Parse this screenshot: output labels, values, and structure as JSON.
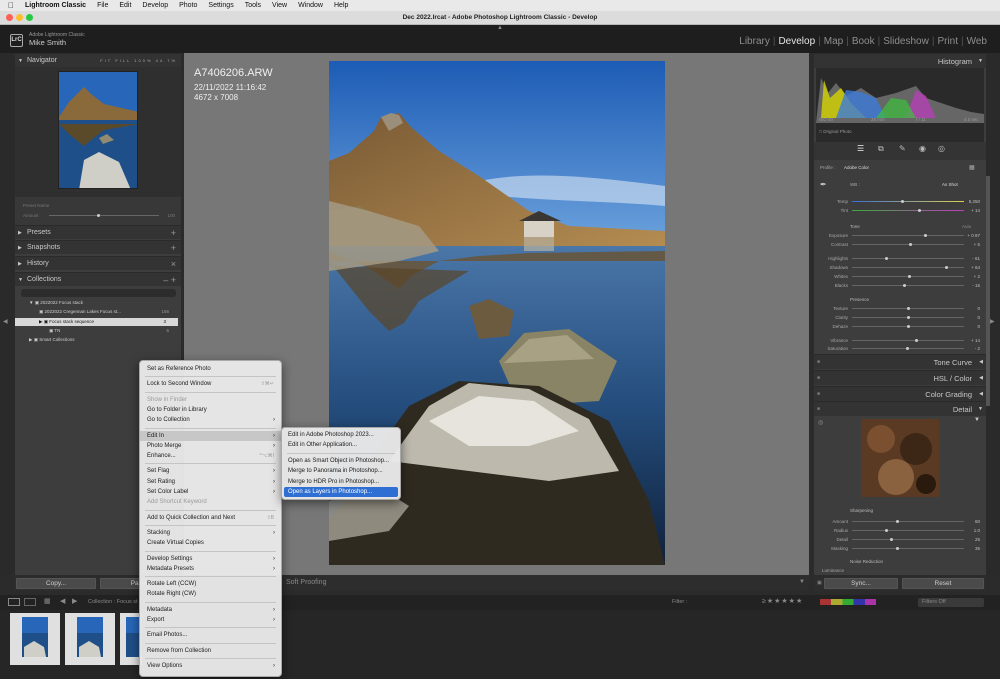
{
  "menubar": {
    "app": "Lightroom Classic",
    "items": [
      "File",
      "Edit",
      "Develop",
      "Photo",
      "Settings",
      "Tools",
      "View",
      "Window",
      "Help"
    ]
  },
  "window": {
    "title": "Dec 2022.lrcat - Adobe Photoshop Lightroom Classic - Develop"
  },
  "identity": {
    "badge": "LrC",
    "product": "Adobe Lightroom Classic",
    "user": "Mike Smith"
  },
  "modules": [
    "Library",
    "Develop",
    "Map",
    "Book",
    "Slideshow",
    "Print",
    "Web"
  ],
  "left_panel": {
    "navigator": "Navigator",
    "nav_zoom": [
      "FIT",
      "FILL",
      "100%",
      "44.7%"
    ],
    "presets": "Presets",
    "snapshots": "Snapshots",
    "history": "History",
    "collections": "Collections",
    "preset_amount": "Preset Name",
    "preset_amount_label": "Amount",
    "preset_amount_value": "100",
    "collection_items": [
      {
        "label": "2022022 Focus stack",
        "count": ""
      },
      {
        "label": "2022022 Cregennan Lakes Focus st...",
        "count": "156"
      },
      {
        "label": "Focus stack sequence",
        "count": "3"
      },
      {
        "label": "TN",
        "count": "6"
      },
      {
        "label": "Smart Collections",
        "count": ""
      }
    ],
    "copy_button": "Copy...",
    "paste_button": "Paste"
  },
  "image_info": {
    "filename": "A7406206.ARW",
    "datetime": "22/11/2022 11:16:42",
    "dimensions": "4672 x 7008"
  },
  "toolbar": {
    "soft_proofing": "Soft Proofing"
  },
  "right_panel": {
    "histogram": "Histogram",
    "hist_info": [
      "ISO 50",
      "28 mm",
      "f / 11",
      "4.0 sec"
    ],
    "original_photo": "Original Photo",
    "profile_label": "Profile :",
    "profile_value": "Adobe Color",
    "wb_label": "WB :",
    "wb_value": "As Shot",
    "basic": [
      {
        "label": "Temp",
        "value": "5,250"
      },
      {
        "label": "Tint",
        "value": "+ 14"
      }
    ],
    "tone_section": "Tone",
    "tone_auto": "Auto",
    "tone": [
      {
        "label": "Exposure",
        "value": "+ 0.97"
      },
      {
        "label": "Contrast",
        "value": "+ 5"
      },
      {
        "label": "Highlights",
        "value": "- 61"
      },
      {
        "label": "Shadows",
        "value": "+ 64"
      },
      {
        "label": "Whites",
        "value": "+ 2"
      },
      {
        "label": "Blacks",
        "value": "- 15"
      }
    ],
    "presence_section": "Presence",
    "presence": [
      {
        "label": "Texture",
        "value": "0"
      },
      {
        "label": "Clarity",
        "value": "0"
      },
      {
        "label": "Dehaze",
        "value": "0"
      },
      {
        "label": "Vibrance",
        "value": "+ 14"
      },
      {
        "label": "Saturation",
        "value": "- 2"
      }
    ],
    "tone_curve": "Tone Curve",
    "hsl": "HSL / Color",
    "color_grading": "Color Grading",
    "detail": "Detail",
    "sharpening_section": "Sharpening",
    "sharpening": [
      {
        "label": "Amount",
        "value": "60"
      },
      {
        "label": "Radius",
        "value": "1.0"
      },
      {
        "label": "Detail",
        "value": "25"
      },
      {
        "label": "Masking",
        "value": "35"
      }
    ],
    "noise_section": "Noise Reduction",
    "luminance": "Luminance",
    "sync_button": "Sync...",
    "reset_button": "Reset"
  },
  "filmbar": {
    "collection": "Collection : Focus st",
    "filter": "Filter :",
    "filters_off": "Filters Off"
  },
  "context_menu": [
    {
      "label": "Set as Reference Photo",
      "sub": false,
      "dis": false
    },
    {
      "sep": true
    },
    {
      "label": "Lock to Second Window",
      "sub": false,
      "dis": false,
      "sc": "⇧⌘↵"
    },
    {
      "sep": true
    },
    {
      "label": "Show in Finder",
      "sub": false,
      "dis": true
    },
    {
      "label": "Go to Folder in Library",
      "sub": false,
      "dis": false
    },
    {
      "label": "Go to Collection",
      "sub": true,
      "dis": false
    },
    {
      "sep": true
    },
    {
      "label": "Edit In",
      "sub": true,
      "dis": false,
      "hl": true
    },
    {
      "label": "Photo Merge",
      "sub": true,
      "dis": false
    },
    {
      "label": "Enhance...",
      "sub": false,
      "dis": false,
      "sc": "^⌥⌘I"
    },
    {
      "sep": true
    },
    {
      "label": "Set Flag",
      "sub": true,
      "dis": false
    },
    {
      "label": "Set Rating",
      "sub": true,
      "dis": false
    },
    {
      "label": "Set Color Label",
      "sub": true,
      "dis": false
    },
    {
      "label": "Add Shortcut Keyword",
      "sub": false,
      "dis": true
    },
    {
      "sep": true
    },
    {
      "label": "Add to Quick Collection and Next",
      "sub": false,
      "dis": false,
      "sc": "⇧B"
    },
    {
      "sep": true
    },
    {
      "label": "Stacking",
      "sub": true,
      "dis": false
    },
    {
      "label": "Create Virtual Copies",
      "sub": false,
      "dis": false
    },
    {
      "sep": true
    },
    {
      "label": "Develop Settings",
      "sub": true,
      "dis": false
    },
    {
      "label": "Metadata Presets",
      "sub": true,
      "dis": false
    },
    {
      "sep": true
    },
    {
      "label": "Rotate Left (CCW)",
      "sub": false,
      "dis": false
    },
    {
      "label": "Rotate Right (CW)",
      "sub": false,
      "dis": false
    },
    {
      "sep": true
    },
    {
      "label": "Metadata",
      "sub": true,
      "dis": false
    },
    {
      "label": "Export",
      "sub": true,
      "dis": false
    },
    {
      "sep": true
    },
    {
      "label": "Email Photos...",
      "sub": false,
      "dis": false
    },
    {
      "sep": true
    },
    {
      "label": "Remove from Collection",
      "sub": false,
      "dis": false
    },
    {
      "sep": true
    },
    {
      "label": "View Options",
      "sub": true,
      "dis": false
    }
  ],
  "submenu": [
    {
      "label": "Edit in Adobe Photoshop 2023...",
      "sel": false
    },
    {
      "label": "Edit in Other Application...",
      "sel": false
    },
    {
      "sep": true
    },
    {
      "label": "Open as Smart Object in Photoshop...",
      "sel": false
    },
    {
      "label": "Merge to Panorama in Photoshop...",
      "sel": false
    },
    {
      "label": "Merge to HDR Pro in Photoshop...",
      "sel": false
    },
    {
      "label": "Open as Layers in Photoshop...",
      "sel": true
    }
  ],
  "colors": {
    "accent": "#2f6fd3",
    "panel": "#3d3d3d",
    "canvas": "#777777"
  }
}
